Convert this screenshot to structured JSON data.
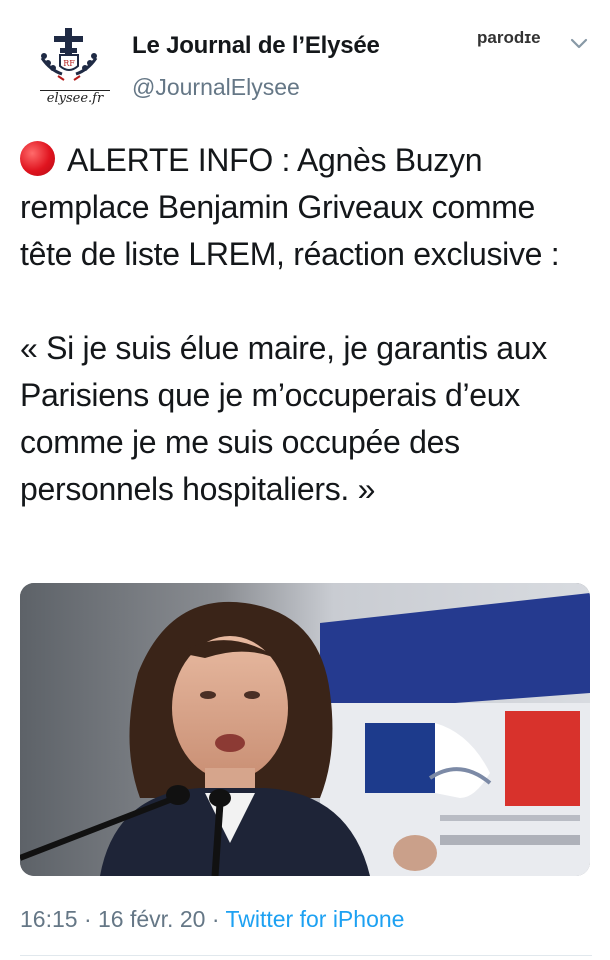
{
  "account": {
    "display_name": "Le Journal de l’Elysée",
    "handle": "@JournalElysee",
    "parody_label": "parodɪe",
    "avatar_caption": "elysee.fr",
    "avatar_icon": "elysee-emblem-icon"
  },
  "menu_icon": "chevron-down-icon",
  "tweet": {
    "alert_icon": "red-circle-icon",
    "line1": "ALERTE INFO : Agnès Buzyn remplace Benjamin Griveaux comme tête de liste LREM, réaction exclusive :",
    "quote": "« Si je suis élue maire, je garantis aux Parisiens que je m’occuperais d’eux comme je me suis occupée des personnels hospitaliers. »"
  },
  "media": {
    "description_icon": "press-photo"
  },
  "meta": {
    "time": "16:15",
    "sep1": " · ",
    "date": "16 févr. 20",
    "sep2": " · ",
    "source": "Twitter for iPhone"
  },
  "colors": {
    "text": "#14171a",
    "secondary": "#657786",
    "link": "#1da1f2",
    "alert": "#e0141f"
  }
}
